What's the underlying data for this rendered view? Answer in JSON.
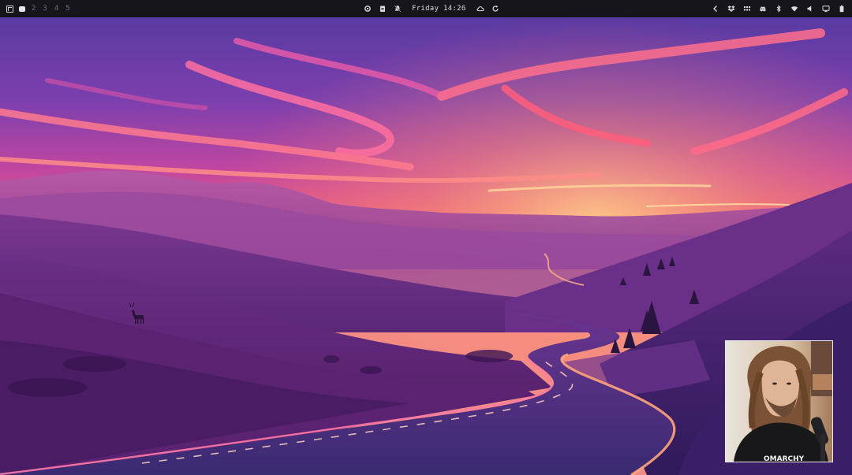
{
  "topbar": {
    "workspaces": [
      "2",
      "3",
      "4",
      "5"
    ],
    "clock": "Friday 14:26",
    "left_icons": [
      "window-layout-icon",
      "active-workspace-dot-icon"
    ],
    "center_icons": [
      "settings-icon",
      "clipboard-icon",
      "notifications-muted-icon",
      "cloud-icon",
      "refresh-icon"
    ],
    "right_icons": [
      "chevron-left-icon",
      "dropbox-icon",
      "grid-dots-icon",
      "discord-icon",
      "bluetooth-icon",
      "wifi-icon",
      "volume-icon",
      "display-icon",
      "battery-icon"
    ]
  },
  "colors": {
    "bar_bg": "#16151c",
    "sky_top": "#5b3aa0",
    "sky_glow": "#ff6a5c",
    "horizon": "#ffb36b",
    "hills": "#5a2a7a",
    "road": "#3a2a6a"
  },
  "webcam": {
    "shirt_text": "OMARCHY"
  }
}
